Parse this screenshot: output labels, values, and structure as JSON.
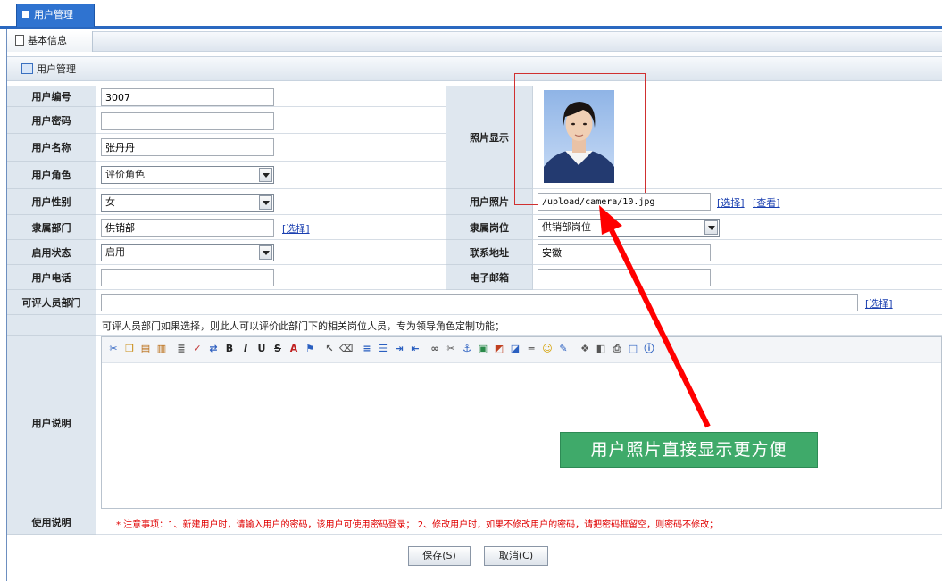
{
  "tabs": {
    "main": "用户管理"
  },
  "subtabs": {
    "basic": "基本信息"
  },
  "section": {
    "title": "用户管理"
  },
  "form": {
    "user_id": {
      "label": "用户编号",
      "value": "3007"
    },
    "password": {
      "label": "用户密码",
      "value": ""
    },
    "user_name": {
      "label": "用户名称",
      "value": "张丹丹"
    },
    "role": {
      "label": "用户角色",
      "value": "评价角色"
    },
    "photo_display": {
      "label": "照片显示"
    },
    "gender": {
      "label": "用户性别",
      "value": "女"
    },
    "photo_path": {
      "label": "用户照片",
      "value": "/upload/camera/10.jpg",
      "select_link": "[选择]",
      "view_link": "[查看]"
    },
    "department": {
      "label": "隶属部门",
      "value": "供销部",
      "select_link": "[选择]"
    },
    "position": {
      "label": "隶属岗位",
      "value": "供销部岗位"
    },
    "status": {
      "label": "启用状态",
      "value": "启用"
    },
    "address": {
      "label": "联系地址",
      "value": "安徽"
    },
    "phone": {
      "label": "用户电话",
      "value": ""
    },
    "email": {
      "label": "电子邮箱",
      "value": ""
    },
    "eval_dept": {
      "label": "可评人员部门",
      "value": "",
      "select_link": "[选择]",
      "hint": "可评人员部门如果选择，则此人可以评价此部门下的相关岗位人员，专为领导角色定制功能；"
    },
    "description": {
      "label": "用户说明"
    },
    "usage": {
      "label": "使用说明",
      "note": "* 注意事项：1、新建用户时，请输入用户的密码，该用户可使用密码登录； 2、修改用户时，如果不修改用户的密码，请把密码框留空，则密码不修改；"
    }
  },
  "buttons": {
    "save": "保存(S)",
    "cancel": "取消(C)"
  },
  "annotation": {
    "text": "用户照片直接显示更方便"
  },
  "colors": {
    "accent": "#2f73d0",
    "label_bg": "#dfe7ef",
    "callout": "#3faa6a",
    "arrow": "#ff0000",
    "note": "#e00000"
  }
}
